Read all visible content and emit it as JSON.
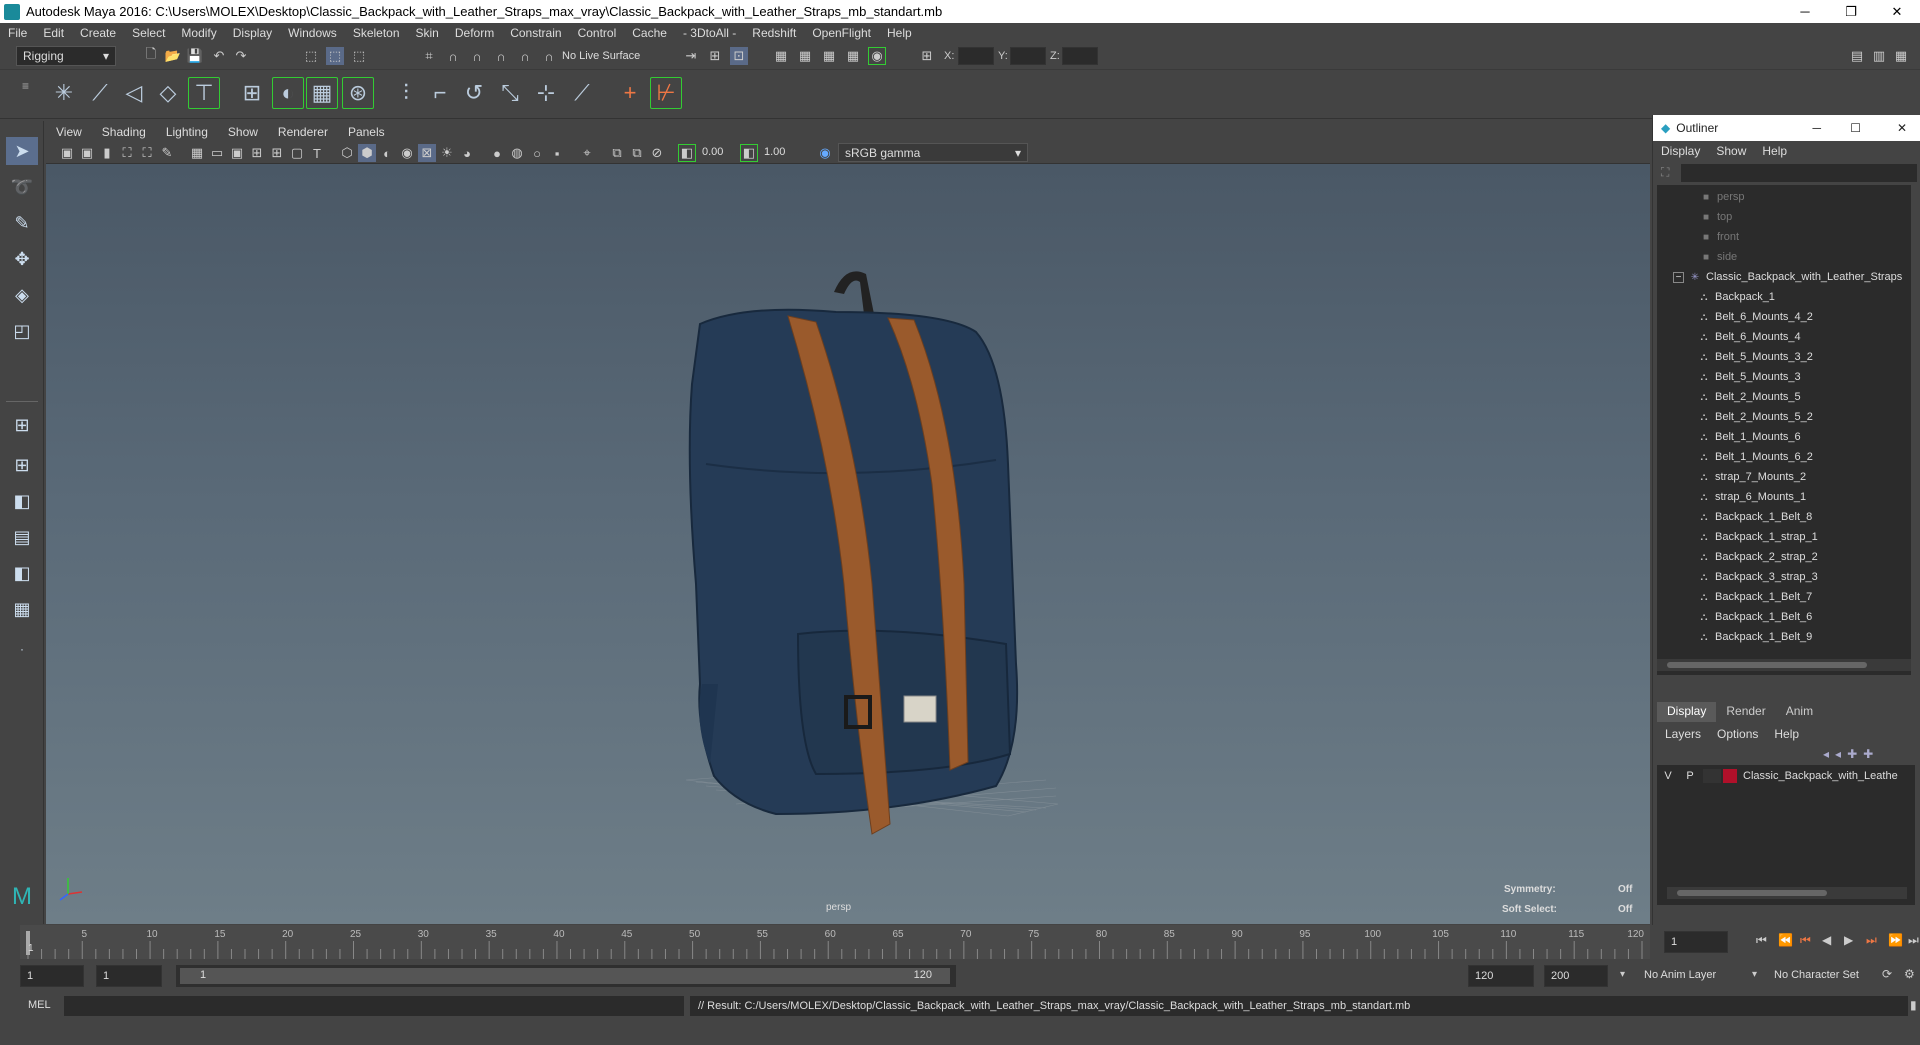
{
  "window": {
    "title": "Autodesk Maya 2016: C:\\Users\\MOLEX\\Desktop\\Classic_Backpack_with_Leather_Straps_max_vray\\Classic_Backpack_with_Leather_Straps_mb_standart.mb",
    "minimize": "─",
    "restore": "❐",
    "close": "✕"
  },
  "menubar": [
    "File",
    "Edit",
    "Create",
    "Select",
    "Modify",
    "Display",
    "Windows",
    "Skeleton",
    "Skin",
    "Deform",
    "Constrain",
    "Control",
    "Cache",
    "- 3DtoAll -",
    "Redshift",
    "OpenFlight",
    "Help"
  ],
  "statusline": {
    "mode": "Rigging",
    "live_surface": "No Live Surface",
    "x_label": "X:",
    "y_label": "Y:",
    "z_label": "Z:"
  },
  "viewport": {
    "menu": [
      "View",
      "Shading",
      "Lighting",
      "Show",
      "Renderer",
      "Panels"
    ],
    "exposure": "0.00",
    "gamma": "1.00",
    "color_space": "sRGB gamma",
    "camera_label": "persp",
    "symmetry_label": "Symmetry:",
    "symmetry_value": "Off",
    "soft_select_label": "Soft Select:",
    "soft_select_value": "Off"
  },
  "outliner": {
    "title": "Outliner",
    "menu": [
      "Display",
      "Show",
      "Help"
    ],
    "cameras": [
      "persp",
      "top",
      "front",
      "side"
    ],
    "root": "Classic_Backpack_with_Leather_Straps",
    "children": [
      "Backpack_1",
      "Belt_6_Mounts_4_2",
      "Belt_6_Mounts_4",
      "Belt_5_Mounts_3_2",
      "Belt_5_Mounts_3",
      "Belt_2_Mounts_5",
      "Belt_2_Mounts_5_2",
      "Belt_1_Mounts_6",
      "Belt_1_Mounts_6_2",
      "strap_7_Mounts_2",
      "strap_6_Mounts_1",
      "Backpack_1_Belt_8",
      "Backpack_1_strap_1",
      "Backpack_2_strap_2",
      "Backpack_3_strap_3",
      "Backpack_1_Belt_7",
      "Backpack_1_Belt_6",
      "Backpack_1_Belt_9"
    ]
  },
  "layers": {
    "tabs": [
      "Display",
      "Render",
      "Anim"
    ],
    "menu": [
      "Layers",
      "Options",
      "Help"
    ],
    "layer_v": "V",
    "layer_p": "P",
    "layer_name": "Classic_Backpack_with_Leathe",
    "layer_color": "#b0102a"
  },
  "timeslider": {
    "ticks": [
      "5",
      "10",
      "15",
      "20",
      "25",
      "30",
      "35",
      "40",
      "45",
      "50",
      "55",
      "60",
      "65",
      "70",
      "75",
      "80",
      "85",
      "90",
      "95",
      "100",
      "105",
      "110",
      "115",
      "120"
    ],
    "start_label": "1",
    "current_frame": "1"
  },
  "range": {
    "start": "1",
    "anim_start": "1",
    "range_start": "1",
    "range_end": "120",
    "end": "120",
    "anim_end": "200",
    "anim_layer": "No Anim Layer",
    "char_set": "No Character Set"
  },
  "cmd": {
    "lang": "MEL",
    "result": "// Result: C:/Users/MOLEX/Desktop/Classic_Backpack_with_Leather_Straps_max_vray/Classic_Backpack_with_Leather_Straps_mb_standart.mb"
  }
}
